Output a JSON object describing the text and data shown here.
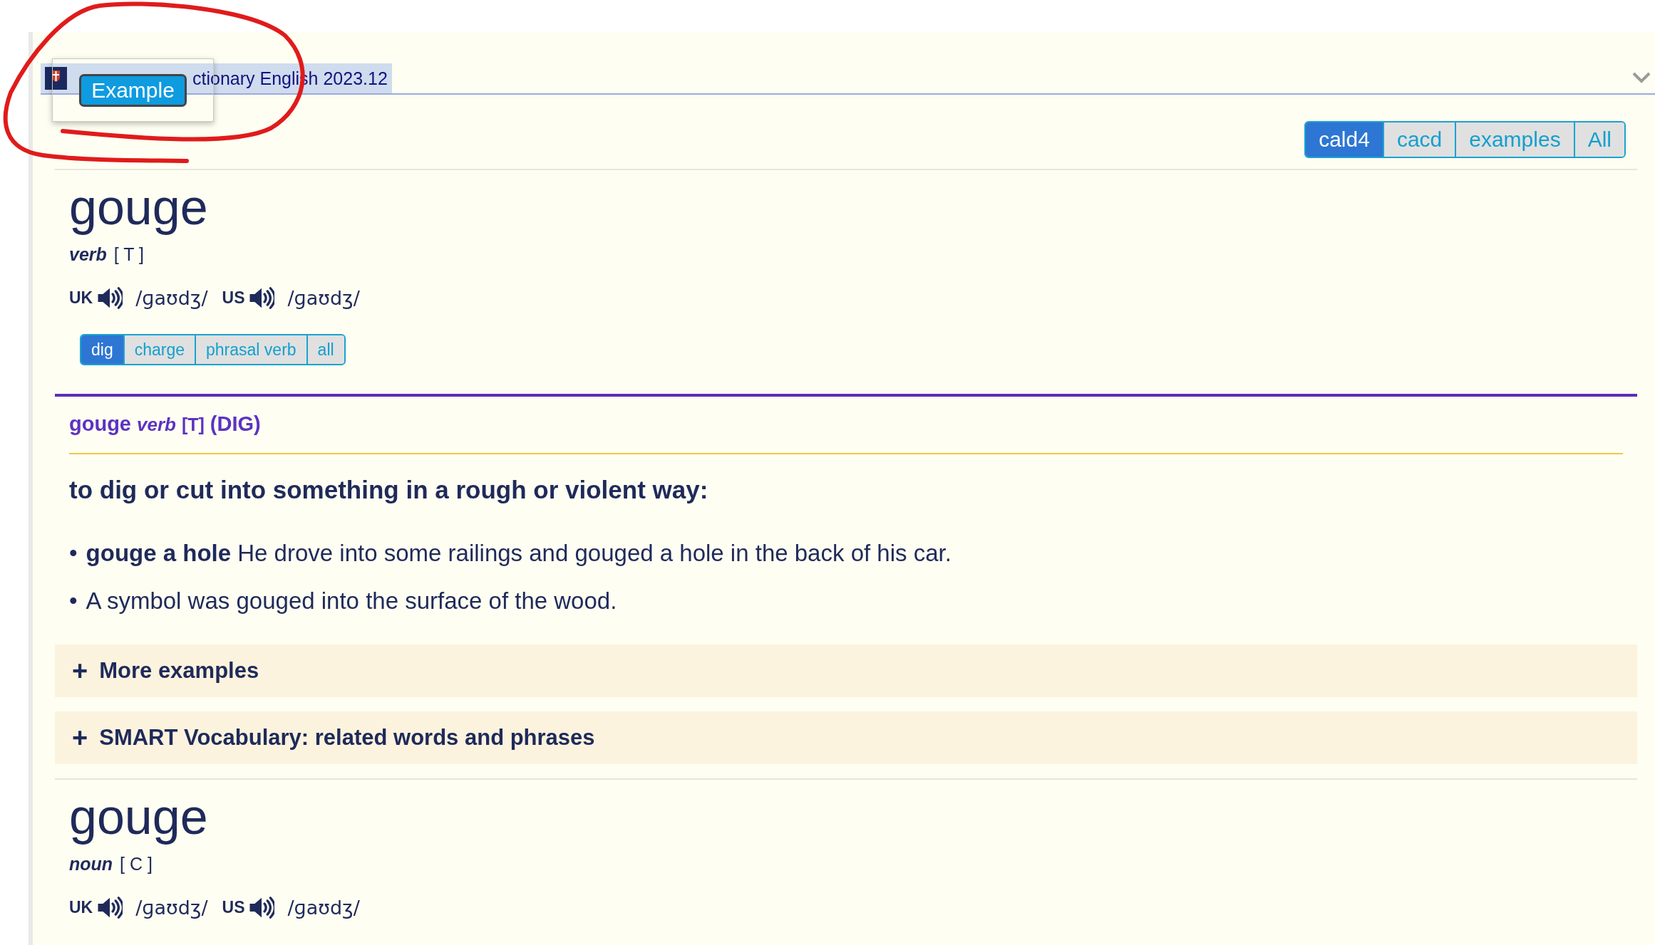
{
  "header": {
    "title": "ctionary English 2023.12"
  },
  "popup": {
    "label": "Example"
  },
  "dictionary_tabs": [
    {
      "label": "cald4",
      "selected": true
    },
    {
      "label": "cacd",
      "selected": false
    },
    {
      "label": "examples",
      "selected": false
    },
    {
      "label": "All",
      "selected": false
    }
  ],
  "entries": [
    {
      "headword": "gouge",
      "pos": "verb",
      "grammar": "[ T ]",
      "pronunciations": [
        {
          "region": "UK",
          "ipa": "/ɡaʊdʒ/"
        },
        {
          "region": "US",
          "ipa": "/ɡaʊdʒ/"
        }
      ],
      "sense_tabs": [
        {
          "label": "dig",
          "selected": true
        },
        {
          "label": "charge",
          "selected": false
        },
        {
          "label": "phrasal verb",
          "selected": false
        },
        {
          "label": "all",
          "selected": false
        }
      ],
      "senses": [
        {
          "word": "gouge",
          "pos": "verb",
          "grammar": "[T]",
          "guide": "(DIG)",
          "definition": "to dig or cut into something in a rough or violent way:",
          "examples": [
            {
              "bullet": "•",
              "text": "**gouge a hole** He drove into some railings and gouged a hole in the back of his car."
            },
            {
              "bullet": "•",
              "text": "A symbol was gouged into the surface of the wood."
            }
          ],
          "sections": [
            {
              "icon": "+",
              "label": "More examples"
            },
            {
              "icon": "+",
              "label": "SMART Vocabulary: related words and phrases"
            }
          ]
        }
      ]
    },
    {
      "headword": "gouge",
      "pos": "noun",
      "grammar": "[ C ]",
      "pronunciations": [
        {
          "region": "UK",
          "ipa": "/ɡaʊdʒ/"
        },
        {
          "region": "US",
          "ipa": "/ɡaʊdʒ/"
        }
      ]
    }
  ]
}
